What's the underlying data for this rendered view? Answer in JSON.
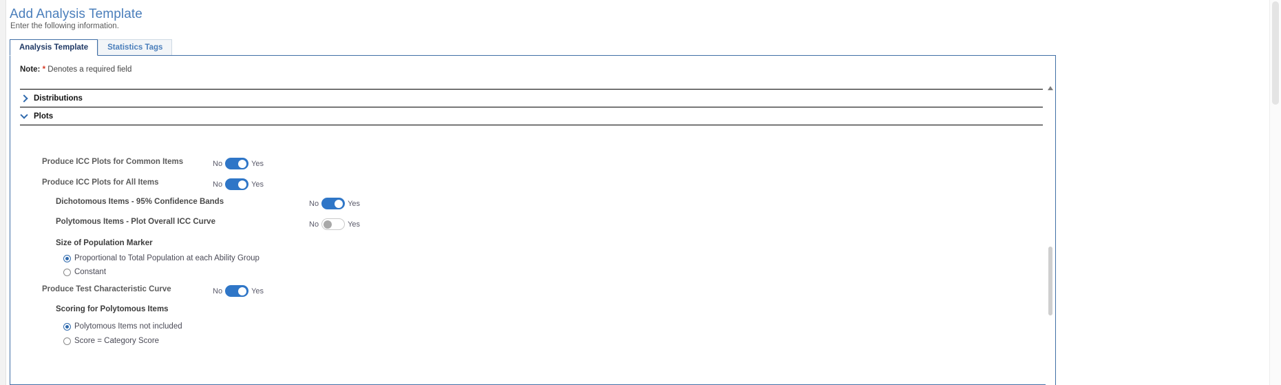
{
  "header": {
    "title": "Add Analysis Template",
    "subtitle": "Enter the following information."
  },
  "tabs": [
    {
      "label": "Analysis Template",
      "active": true
    },
    {
      "label": "Statistics Tags",
      "active": false
    }
  ],
  "note": {
    "prefix": "Note:",
    "star": "*",
    "text": "Denotes a required field"
  },
  "sections": [
    {
      "label": "Distributions",
      "expanded": false,
      "icon": "chevron-right-icon"
    },
    {
      "label": "Plots",
      "expanded": true,
      "icon": "chevron-down-icon"
    }
  ],
  "toggle_labels": {
    "off": "No",
    "on": "Yes"
  },
  "fields": {
    "icc_common": {
      "label": "Produce ICC Plots for Common Items",
      "value": "Yes"
    },
    "icc_all": {
      "label": "Produce ICC Plots for All Items",
      "value": "Yes"
    },
    "dichotomous_bands": {
      "label": "Dichotomous Items - 95% Confidence Bands",
      "value": "Yes"
    },
    "polytomous_overall": {
      "label": "Polytomous Items - Plot Overall ICC Curve",
      "value": "No"
    },
    "test_characteristic_curve": {
      "label": "Produce Test Characteristic Curve",
      "value": "Yes"
    }
  },
  "groups": {
    "population_marker": {
      "label": "Size of Population Marker",
      "options": [
        {
          "label": "Proportional to Total Population at each Ability Group",
          "selected": true
        },
        {
          "label": "Constant",
          "selected": false
        }
      ]
    },
    "polytomous_scoring": {
      "label": "Scoring for Polytomous Items",
      "options": [
        {
          "label": "Polytomous Items not included",
          "selected": true
        },
        {
          "label": "Score = Category Score",
          "selected": false
        }
      ]
    }
  },
  "colors": {
    "accent": "#2f76c7",
    "title": "#4a7ebb",
    "tab_active_text": "#1f3864",
    "required_star": "#d63b26"
  }
}
